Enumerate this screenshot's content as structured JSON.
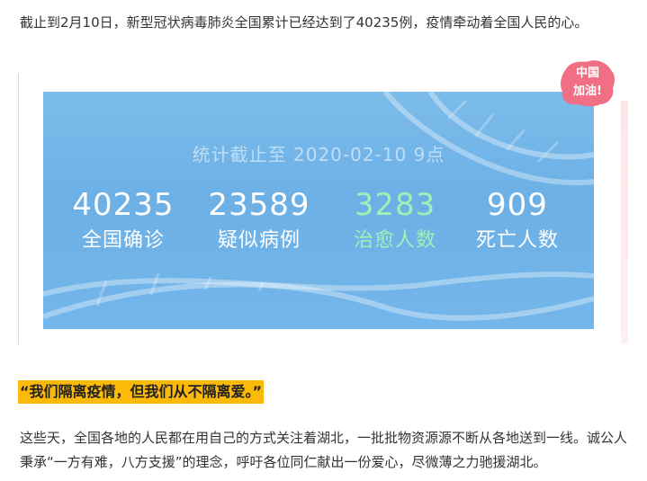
{
  "intro": "截止到2月10日，新型冠状病毒肺炎全国累计已经达到了40235例，疫情牵动着全国人民的心。",
  "stats_card": {
    "timestamp": "统计截止至 2020-02-10 9点",
    "stats": [
      {
        "value": "40235",
        "label": "全国确诊",
        "color": "#ffffff"
      },
      {
        "value": "23589",
        "label": "疑似病例",
        "color": "#ffffff"
      },
      {
        "value": "3283",
        "label": "治愈人数",
        "color": "#9ff0b6"
      },
      {
        "value": "909",
        "label": "死亡人数",
        "color": "#ffffff"
      }
    ],
    "background_color": "#74b6ea"
  },
  "badge": {
    "line1": "中国",
    "line2": "加油!",
    "color": "#f06f85"
  },
  "heading": "“我们隔离疫情，但我们从不隔离爱。”",
  "heading_highlight_color": "#fbb90a",
  "body": "这些天，全国各地的人民都在用自己的方式关注着湖北，一批批物资源源不断从各地送到一线。诚公人秉承“一方有难，八方支援”的理念，呼吁各位同仁献出一份爱心，尽微薄之力驰援湖北。"
}
